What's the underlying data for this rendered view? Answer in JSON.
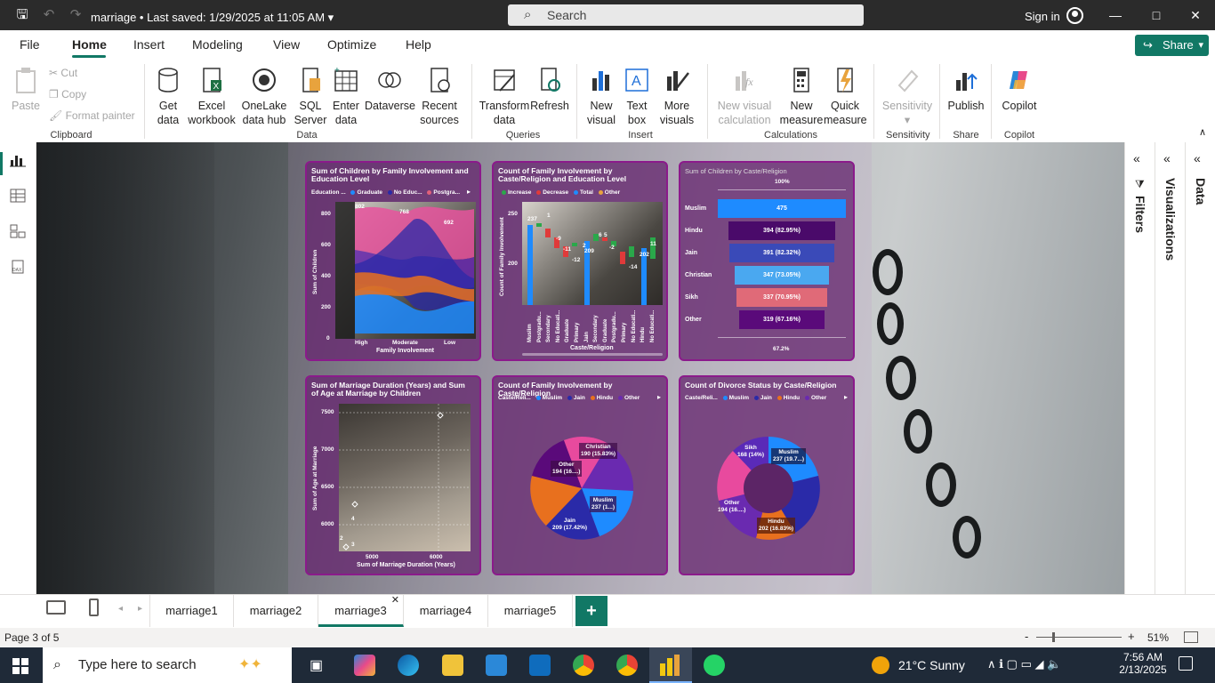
{
  "titlebar": {
    "title": "marriage • Last saved: 1/29/2025 at 11:05 AM",
    "search_placeholder": "Search",
    "sign_in": "Sign in"
  },
  "menu": {
    "items": [
      "File",
      "Home",
      "Insert",
      "Modeling",
      "View",
      "Optimize",
      "Help"
    ],
    "share": "Share"
  },
  "ribbon": {
    "clipboard": {
      "paste": "Paste",
      "cut": "Cut",
      "copy": "Copy",
      "format_painter": "Format painter",
      "label": "Clipboard"
    },
    "data": {
      "get_data": "Get data",
      "excel": "Excel workbook",
      "onelake": "OneLake data hub",
      "sql": "SQL Server",
      "enter": "Enter data",
      "dataverse": "Dataverse",
      "recent": "Recent sources",
      "label": "Data"
    },
    "queries": {
      "transform": "Transform data",
      "refresh": "Refresh",
      "label": "Queries"
    },
    "insert": {
      "new_visual": "New visual",
      "text_box": "Text box",
      "more_visuals": "More visuals",
      "label": "Insert"
    },
    "calculations": {
      "new_visual_calc": "New visual calculation",
      "new_measure": "New measure",
      "quick_measure": "Quick measure",
      "label": "Calculations"
    },
    "sensitivity": {
      "button": "Sensitivity",
      "label": "Sensitivity"
    },
    "share": {
      "publish": "Publish",
      "label": "Share"
    },
    "copilot": {
      "button": "Copilot",
      "label": "Copilot"
    }
  },
  "side_panels": {
    "filters": "Filters",
    "visualizations": "Visualizations",
    "data": "Data"
  },
  "tabs": [
    "marriage1",
    "marriage2",
    "marriage3",
    "marriage4",
    "marriage5"
  ],
  "active_tab": "marriage3",
  "status": {
    "page": "Page 3 of 5",
    "zoom": "51%"
  },
  "taskbar": {
    "search": "Type here to search",
    "weather": "21°C  Sunny",
    "time": "7:56 AM",
    "date": "2/13/2025"
  },
  "chart_data": [
    {
      "type": "area",
      "title": "Sum of Children by Family Involvement and Education Level",
      "legend_title": "Education ...",
      "legend": [
        "Graduate",
        "No Educ...",
        "Postgra..."
      ],
      "categories": [
        "High",
        "Moderate",
        "Low"
      ],
      "yticks": [
        "800",
        "600",
        "400",
        "200",
        "0"
      ],
      "xlabel": "Family Involvement",
      "ylabel": "Sum of Children",
      "data_labels": [
        "802",
        "768",
        "692"
      ]
    },
    {
      "type": "bar",
      "title": "Count of Family Involvement by Caste/Religion and Education Level",
      "legend": [
        "Increase",
        "Decrease",
        "Total",
        "Other"
      ],
      "yticks": [
        "250",
        "200"
      ],
      "ylabel": "Count of Family Involvement",
      "xlabel": "Caste/Religion",
      "x": [
        "Muslim",
        "Postgradu...",
        "Secondary",
        "No Educati...",
        "Graduate",
        "Primary",
        "Jain",
        "Secondary",
        "Graduate",
        "Postgradu...",
        "Primary",
        "No Educati...",
        "Hindu",
        "No Educati..."
      ],
      "data_labels": [
        "237",
        "1",
        "-9",
        "-11",
        "-12",
        "2",
        "6",
        "-2",
        "5",
        "-14",
        "11",
        "209",
        "202"
      ]
    },
    {
      "type": "bar",
      "title": "Sum of Children by Caste/Religion",
      "top_label": "100%",
      "bottom_label": "67.2%",
      "categories": [
        "Muslim",
        "Hindu",
        "Jain",
        "Christian",
        "Sikh",
        "Other"
      ],
      "values": [
        475,
        394,
        391,
        347,
        337,
        319
      ],
      "labels": [
        "475",
        "394 (82.95%)",
        "391 (82.32%)",
        "347 (73.05%)",
        "337 (70.95%)",
        "319 (67.16%)"
      ]
    },
    {
      "type": "scatter",
      "title": "Sum of Marriage Duration (Years) and Sum of Age at Marriage by Children",
      "xlabel": "Sum of Marriage Duration (Years)",
      "ylabel": "Sum of Age at Marriage",
      "yticks": [
        "7500",
        "7000",
        "6500",
        "6000"
      ],
      "xticks": [
        "5000",
        "6000"
      ],
      "point_labels": [
        "4",
        "2",
        "3"
      ]
    },
    {
      "type": "pie",
      "title": "Count of Family Involvement by Caste/Religion",
      "legend_title": "Caste/Reli...",
      "legend": [
        "Muslim",
        "Jain",
        "Hindu",
        "Other"
      ],
      "slices": [
        {
          "label": "Muslim",
          "text": "237 (1...)",
          "value": 237
        },
        {
          "label": "Jain",
          "text": "209 (17.42%)",
          "value": 209
        },
        {
          "label": "Other",
          "text": "194 (16....)",
          "value": 194
        },
        {
          "label": "Christian",
          "text": "190 (15.83%)",
          "value": 190
        }
      ]
    },
    {
      "type": "pie",
      "title": "Count of Divorce Status by Caste/Religion",
      "legend_title": "Caste/Reli...",
      "legend": [
        "Muslim",
        "Jain",
        "Hindu",
        "Other"
      ],
      "slices": [
        {
          "label": "Muslim",
          "text": "237 (19.7...)",
          "value": 237
        },
        {
          "label": "Hindu",
          "text": "202 (16.83%)",
          "value": 202
        },
        {
          "label": "Other",
          "text": "194 (16....)",
          "value": 194
        },
        {
          "label": "Sikh",
          "text": "168 (14%)",
          "value": 168
        }
      ]
    }
  ]
}
